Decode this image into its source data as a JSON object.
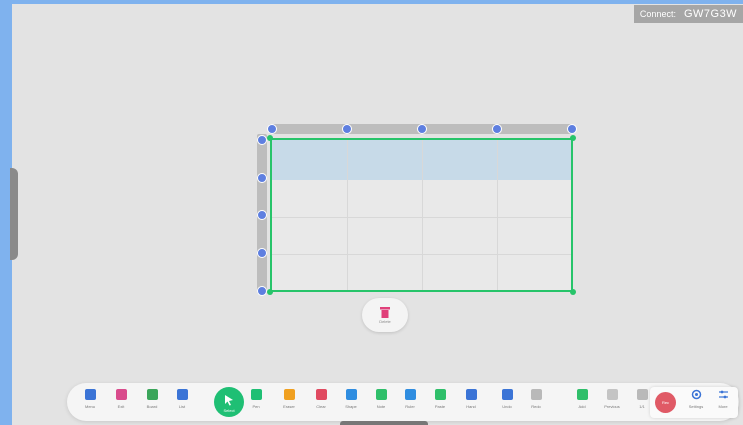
{
  "connect": {
    "label": "Connect:",
    "code": "GW7G3W"
  },
  "delete_popup": {
    "label": "Delete"
  },
  "toolbar": {
    "tools": [
      {
        "name": "menu",
        "label": "Menu",
        "icon": "menu-icon",
        "color": "#3b74d6"
      },
      {
        "name": "exit",
        "label": "Exit",
        "icon": "close-circle-icon",
        "color": "#d94b8c"
      },
      {
        "name": "board",
        "label": "Board",
        "icon": "board-icon",
        "color": "#3aa55a"
      },
      {
        "name": "list",
        "label": "List",
        "icon": "list-icon",
        "color": "#3b74d6"
      },
      {
        "name": "pen",
        "label": "Pen",
        "icon": "pen-icon",
        "color": "#1fbf74"
      },
      {
        "name": "eraser",
        "label": "Eraser",
        "icon": "eraser-icon",
        "color": "#f0a020"
      },
      {
        "name": "clear",
        "label": "Clear",
        "icon": "broom-icon",
        "color": "#e04a60"
      },
      {
        "name": "shape",
        "label": "Shape",
        "icon": "shape-icon",
        "color": "#2f8de0"
      },
      {
        "name": "note",
        "label": "Note",
        "icon": "note-icon",
        "color": "#2fbf6a"
      },
      {
        "name": "ruler",
        "label": "Ruler",
        "icon": "ruler-icon",
        "color": "#2f8de0"
      },
      {
        "name": "paste",
        "label": "Paste",
        "icon": "paste-icon",
        "color": "#2fbf6a"
      },
      {
        "name": "hand",
        "label": "Hand",
        "icon": "hand-icon",
        "color": "#3b74d6"
      },
      {
        "name": "undo",
        "label": "Undo",
        "icon": "undo-icon",
        "color": "#3b74d6"
      },
      {
        "name": "redo",
        "label": "Redo",
        "icon": "redo-icon",
        "color": "#b9b9b9"
      },
      {
        "name": "add",
        "label": "Add",
        "icon": "add-page-icon",
        "color": "#2fbf6a"
      },
      {
        "name": "previous",
        "label": "Previous",
        "icon": "page-icon",
        "color": "#c4c4c4"
      },
      {
        "name": "page",
        "label": "1/1",
        "icon": "page-count-icon",
        "color": "#b9b9b9"
      }
    ],
    "select": {
      "label": "Select"
    },
    "record": {
      "label": "Rec"
    },
    "settings": {
      "label": "Settings"
    },
    "more": {
      "label": "More"
    }
  },
  "colors": {
    "accent": "#1fbf74",
    "handle": "#5e7fe0",
    "record": "#e05a66"
  }
}
